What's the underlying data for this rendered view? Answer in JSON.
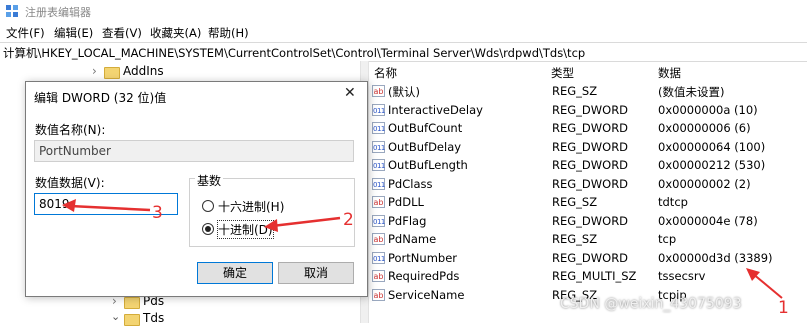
{
  "window": {
    "title": "注册表编辑器"
  },
  "menu": [
    "文件(F)",
    "编辑(E)",
    "查看(V)",
    "收藏夹(A)",
    "帮助(H)"
  ],
  "address": "计算机\\HKEY_LOCAL_MACHINE\\SYSTEM\\CurrentControlSet\\Control\\Terminal Server\\Wds\\rdpwd\\Tds\\tcp",
  "tree": {
    "addins": "AddIns",
    "pds": "Pds",
    "tds": "Tds"
  },
  "list": {
    "headers": {
      "name": "名称",
      "type": "类型",
      "data": "数据"
    },
    "rows": [
      {
        "name": "(默认)",
        "type": "REG_SZ",
        "data": "(数值未设置)",
        "icon": "string-value-icon"
      },
      {
        "name": "InteractiveDelay",
        "type": "REG_DWORD",
        "data": "0x0000000a (10)",
        "icon": "binary-value-icon"
      },
      {
        "name": "OutBufCount",
        "type": "REG_DWORD",
        "data": "0x00000006 (6)",
        "icon": "binary-value-icon"
      },
      {
        "name": "OutBufDelay",
        "type": "REG_DWORD",
        "data": "0x00000064 (100)",
        "icon": "binary-value-icon"
      },
      {
        "name": "OutBufLength",
        "type": "REG_DWORD",
        "data": "0x00000212 (530)",
        "icon": "binary-value-icon"
      },
      {
        "name": "PdClass",
        "type": "REG_DWORD",
        "data": "0x00000002 (2)",
        "icon": "binary-value-icon"
      },
      {
        "name": "PdDLL",
        "type": "REG_SZ",
        "data": "tdtcp",
        "icon": "string-value-icon"
      },
      {
        "name": "PdFlag",
        "type": "REG_DWORD",
        "data": "0x0000004e (78)",
        "icon": "binary-value-icon"
      },
      {
        "name": "PdName",
        "type": "REG_SZ",
        "data": "tcp",
        "icon": "string-value-icon"
      },
      {
        "name": "PortNumber",
        "type": "REG_DWORD",
        "data": "0x00000d3d (3389)",
        "icon": "binary-value-icon"
      },
      {
        "name": "RequiredPds",
        "type": "REG_MULTI_SZ",
        "data": "tssecsrv",
        "icon": "string-value-icon"
      },
      {
        "name": "ServiceName",
        "type": "REG_SZ",
        "data": "tcpip",
        "icon": "string-value-icon"
      }
    ]
  },
  "dialog": {
    "title": "编辑 DWORD (32 位)值",
    "value_name_label": "数值名称(N):",
    "value_name": "PortNumber",
    "value_data_label": "数值数据(V):",
    "value_data": "8019",
    "base_label": "基数",
    "hex_label": "十六进制(H)",
    "dec_label": "十进制(D)",
    "selected_base": "dec",
    "ok_label": "确定",
    "cancel_label": "取消",
    "close_glyph": "✕"
  },
  "annotations": {
    "num1": "1",
    "num2": "2",
    "num3": "3",
    "color": "#e53030"
  },
  "watermark": "CSDN @weixin_43075093"
}
